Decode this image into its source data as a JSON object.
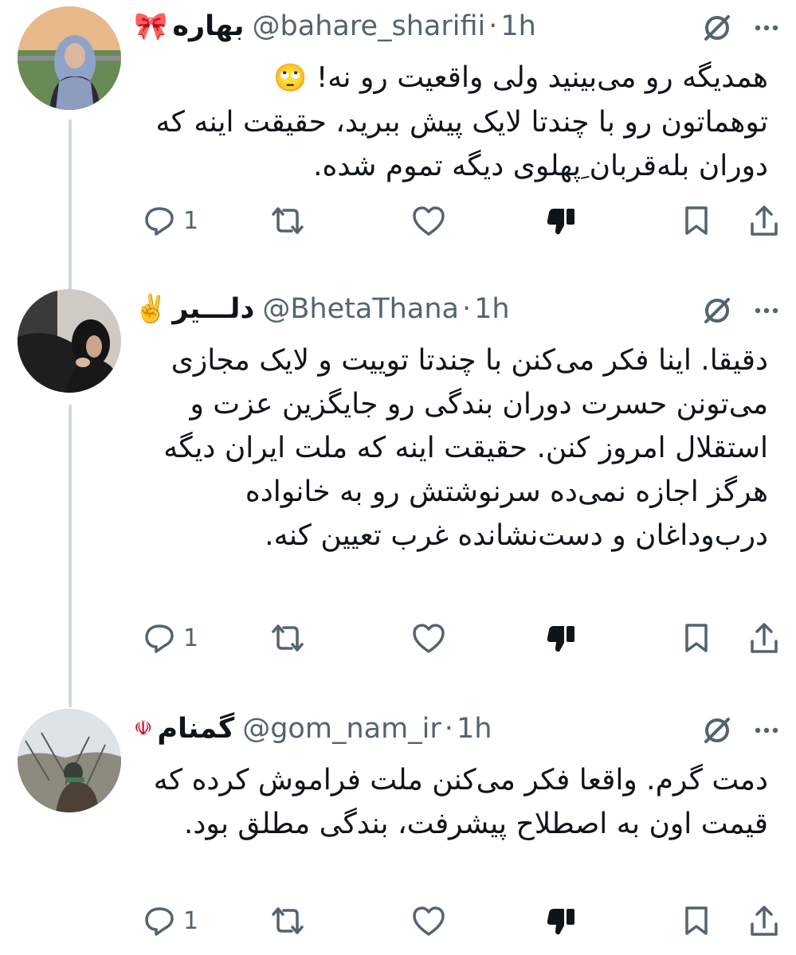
{
  "tweets": [
    {
      "emoji": "🎀",
      "name": "بهاره",
      "handle": "@bahare_sharifii",
      "time": "1h",
      "emoji_inline": "🙄",
      "text_first": "همدیگه رو می‌بینید ولی واقعیت رو نه!",
      "text_rest": "توهماتون رو با چندتا لایک پیش ببرید، حقیقت اینه که دوران بله‌قربان ِپهلوی دیگه تموم شده.",
      "reply_count": "1"
    },
    {
      "emoji": "✌️",
      "name": "دلـــیر",
      "handle": "@BhetaThana",
      "time": "1h",
      "text": "دقیقا. اینا فکر می‌کنن با چندتا توییت و لایک مجازی می‌تونن حسرت دوران بندگی رو جایگزین عزت و استقلال امروز کنن. حقیقت اینه که ملت ایران دیگه هرگز اجازه نمی‌ده سرنوشتش رو به خانواده درب‌وداغان و دست‌نشانده غرب تعیین کنه.",
      "reply_count": "1"
    },
    {
      "emoji": "☫",
      "name": "گمنام",
      "handle": "@gom_nam_ir",
      "time": "1h",
      "text": "دمت گرم. واقعا فکر می‌کنن ملت فراموش کرده که قیمت اون به اصطلاح پیشرفت، بندگی مطلق بود.",
      "reply_count": "1"
    }
  ],
  "sep": "·",
  "icons": [
    "reply-icon",
    "retweet-icon",
    "like-icon",
    "dislike-icon",
    "bookmark-icon",
    "share-icon",
    "grok-icon",
    "more-icon"
  ],
  "colors": {
    "text": "#0f1419",
    "secondary": "#536471",
    "thread_line": "#cfd9de"
  }
}
